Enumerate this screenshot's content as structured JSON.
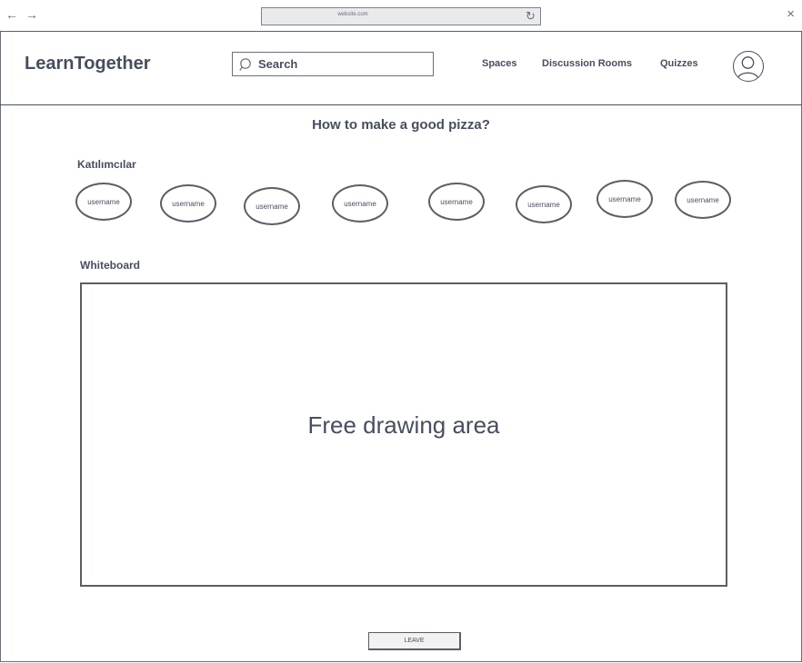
{
  "browser": {
    "back_icon": "←",
    "forward_icon": "→",
    "url": "website.com",
    "reload_icon": "↻",
    "close_icon": "×"
  },
  "header": {
    "logo": "LearnTogether",
    "search_label": "Search",
    "nav": [
      "Spaces",
      "Discussion Rooms",
      "Quizzes"
    ]
  },
  "page": {
    "title": "How to make a good pizza?",
    "participants_label": "Katılımcılar",
    "participants": [
      "username",
      "username",
      "username",
      "username",
      "username",
      "username",
      "username",
      "username"
    ],
    "whiteboard_label": "Whiteboard",
    "whiteboard_placeholder": "Free drawing area",
    "leave_label": "LEAVE"
  }
}
